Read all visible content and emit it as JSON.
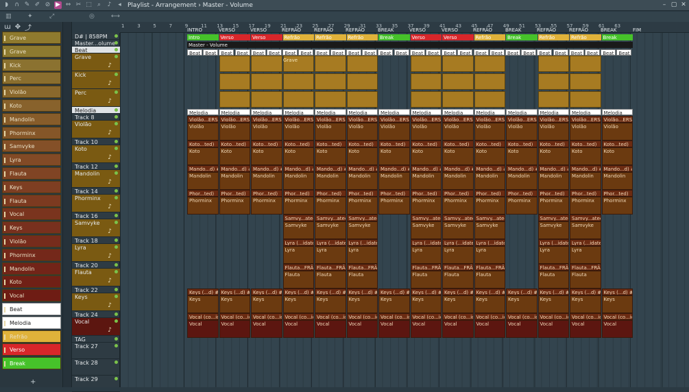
{
  "window": {
    "title": "Playlist - Arrangement › Master - Volume"
  },
  "left_panel": {
    "patterns": [
      {
        "label": "Grave",
        "color": "#8f7a2e"
      },
      {
        "label": "Grave",
        "color": "#8d7a30"
      },
      {
        "label": "Kick",
        "color": "#8b7230"
      },
      {
        "label": "Perc",
        "color": "#8a6e2e"
      },
      {
        "label": "Violão",
        "color": "#8a682c"
      },
      {
        "label": "Koto",
        "color": "#88622c"
      },
      {
        "label": "Mandolin",
        "color": "#875c2a"
      },
      {
        "label": "Phorminx",
        "color": "#855628"
      },
      {
        "label": "Samvyke",
        "color": "#845028"
      },
      {
        "label": "Lyra",
        "color": "#824a26"
      },
      {
        "label": "Flauta",
        "color": "#804424"
      },
      {
        "label": "Keys",
        "color": "#7e3e22"
      },
      {
        "label": "Flauta",
        "color": "#7c3a20"
      },
      {
        "label": "Vocal",
        "color": "#7a341e"
      },
      {
        "label": "Keys",
        "color": "#78301e"
      },
      {
        "label": "Violão",
        "color": "#762c1c"
      },
      {
        "label": "Phorminx",
        "color": "#74281a"
      },
      {
        "label": "Mandolin",
        "color": "#722418"
      },
      {
        "label": "Koto",
        "color": "#702016"
      },
      {
        "label": "Vocal",
        "color": "#6e1c14"
      },
      {
        "label": "Beat",
        "color": "#ffffff"
      },
      {
        "label": "Melodia",
        "color": "#ffffff"
      },
      {
        "label": "Refrão",
        "color": "#e0b23a"
      },
      {
        "label": "Verso",
        "color": "#d8262a"
      },
      {
        "label": "Break",
        "color": "#46c22a"
      }
    ]
  },
  "tracks": [
    {
      "name": "D# | 858PM"
    },
    {
      "name": "Master...olume"
    },
    {
      "name": "Beat"
    },
    {
      "name": "Grave"
    },
    {
      "name": "Kick"
    },
    {
      "name": "Perc"
    },
    {
      "name": "Melodia"
    },
    {
      "name": "Track 8"
    },
    {
      "name": "Violão"
    },
    {
      "name": "Track 10"
    },
    {
      "name": "Koto"
    },
    {
      "name": "Track 12"
    },
    {
      "name": "Mandolin"
    },
    {
      "name": "Track 14"
    },
    {
      "name": "Phorminx"
    },
    {
      "name": "Track 16"
    },
    {
      "name": "Samvyke"
    },
    {
      "name": "Track 18"
    },
    {
      "name": "Lyra"
    },
    {
      "name": "Track 20"
    },
    {
      "name": "Flauta"
    },
    {
      "name": "Track 22"
    },
    {
      "name": "Keys"
    },
    {
      "name": "Track 24"
    },
    {
      "name": "Vocal"
    },
    {
      "name": "TAG"
    },
    {
      "name": "Track 27"
    },
    {
      "name": "Track 28"
    },
    {
      "name": "Track 29"
    }
  ],
  "ruler": [
    "1",
    "3",
    "5",
    "7",
    "9",
    "11",
    "13",
    "15",
    "17",
    "19",
    "21",
    "23",
    "25",
    "27",
    "29",
    "31",
    "33",
    "35",
    "37",
    "39",
    "41",
    "43",
    "45",
    "47",
    "49",
    "51",
    "53",
    "55",
    "57",
    "59",
    "61",
    "63"
  ],
  "markers": [
    "INTRO",
    "VERSO",
    "VERSO",
    "REFRÃO",
    "REFRÃO",
    "REFRÃO",
    "BREAK",
    "VERSO",
    "VERSO",
    "REFRÃO",
    "BREAK",
    "REFRÃO",
    "REFRÃO",
    "BREAK",
    "FIM"
  ],
  "section_clips": [
    {
      "label": "Intro",
      "color": "#46c22a"
    },
    {
      "label": "Verso",
      "color": "#d8262a"
    },
    {
      "label": "Verso",
      "color": "#d8262a"
    },
    {
      "label": "Refrão",
      "color": "#e0b23a"
    },
    {
      "label": "Refrão",
      "color": "#e0b23a"
    },
    {
      "label": "Refrão",
      "color": "#e0b23a"
    },
    {
      "label": "Break",
      "color": "#46c22a"
    },
    {
      "label": "Verso",
      "color": "#d8262a"
    },
    {
      "label": "Verso",
      "color": "#d8262a"
    },
    {
      "label": "Refrão",
      "color": "#e0b23a"
    },
    {
      "label": "Break",
      "color": "#46c22a"
    },
    {
      "label": "Refrão",
      "color": "#e0b23a"
    },
    {
      "label": "Refrão",
      "color": "#e0b23a"
    },
    {
      "label": "Break",
      "color": "#46c22a"
    }
  ],
  "master_clip": "Master - Volume",
  "beat_clip": "Beat",
  "melodia_clip": "Melodia",
  "grave_clip": "Grave",
  "lanes": {
    "violao": {
      "auto": "Violão...ERSO",
      "name": "Violão"
    },
    "koto": {
      "auto": "Koto...ted)",
      "name": "Koto"
    },
    "mandolin": {
      "auto": "Mando...d) #2",
      "name": "Mandolin"
    },
    "phorminx": {
      "auto": "Phor...ted)",
      "name": "Phorminx"
    },
    "samvyke": {
      "auto": "Samvy...ated",
      "name": "Samvyke"
    },
    "lyra": {
      "auto": "Lyra (...idated)",
      "name": "Lyra"
    },
    "flauta": {
      "auto": "Flauta...FRÃO",
      "name": "Flauta"
    },
    "keys": {
      "auto": "Keys (...d) #2",
      "name": "Keys"
    },
    "vocal": {
      "auto": "Vocal (co...id",
      "name": "Vocal"
    }
  }
}
